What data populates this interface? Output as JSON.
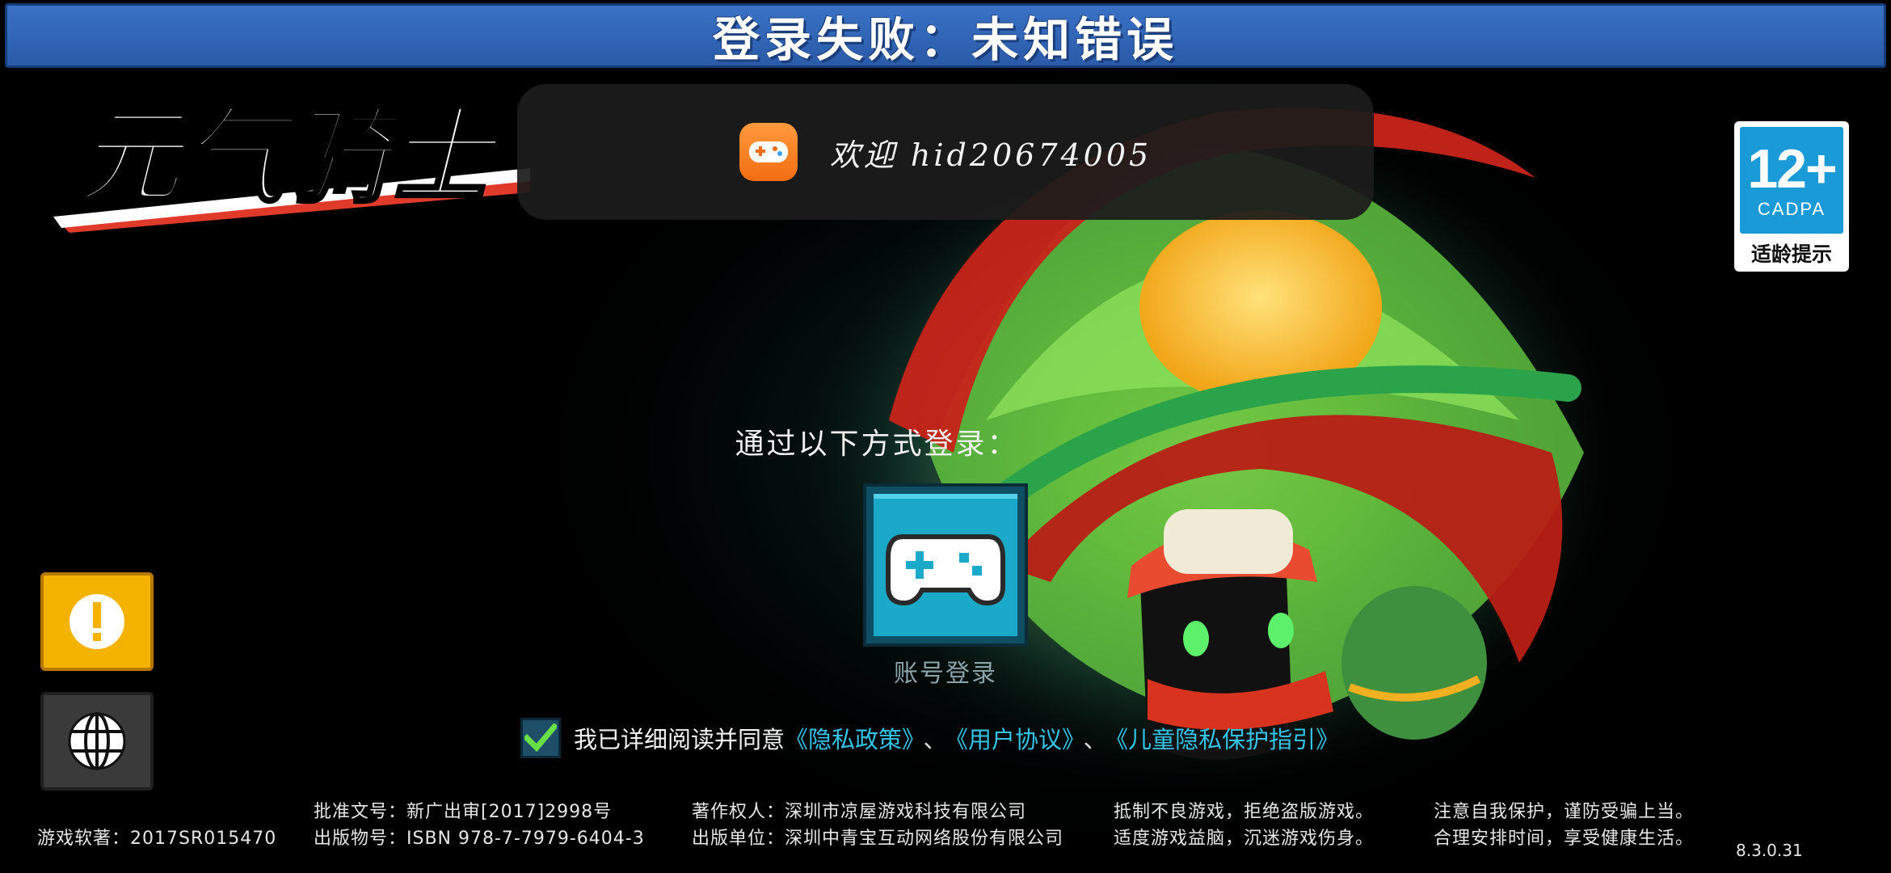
{
  "banner": {
    "error_text": "登录失败：未知错误"
  },
  "logo": {
    "text": "元气骑士"
  },
  "toast": {
    "welcome_text": "欢迎 hid20674005",
    "icon": "gamepad-icon"
  },
  "age_rating": {
    "number": "12+",
    "org": "CADPA",
    "label": "适龄提示"
  },
  "login": {
    "prompt": "通过以下方式登录：",
    "account_button_icon": "gamepad-icon",
    "account_label": "账号登录"
  },
  "side_buttons": {
    "warning_icon": "exclamation-icon",
    "language_icon": "globe-icon"
  },
  "agreement": {
    "checked": true,
    "prefix": "我已详细阅读并同意",
    "privacy_policy": "《隐私政策》",
    "separator": "、",
    "user_agreement": "《用户协议》",
    "children_privacy": "《儿童隐私保护指引》"
  },
  "footer": {
    "software_copyright": "游戏软著：2017SR015470",
    "approval_no": "批准文号：新广出审[2017]2998号",
    "publication_no": "出版物号：ISBN 978-7-7979-6404-3",
    "copyright_owner": "著作权人：深圳市凉屋游戏科技有限公司",
    "publisher": "出版单位：深圳中青宝互动网络股份有限公司",
    "health_line1": "抵制不良游戏，拒绝盗版游戏。",
    "health_line2": "适度游戏益脑，沉迷游戏伤身。",
    "health_line3": "注意自我保护，谨防受骗上当。",
    "health_line4": "合理安排时间，享受健康生活。",
    "version": "8.3.0.31"
  },
  "colors": {
    "banner": "#2a5aa8",
    "link": "#33c3e6",
    "warning_button": "#f5b301",
    "account_button": "#1aa9c8"
  }
}
